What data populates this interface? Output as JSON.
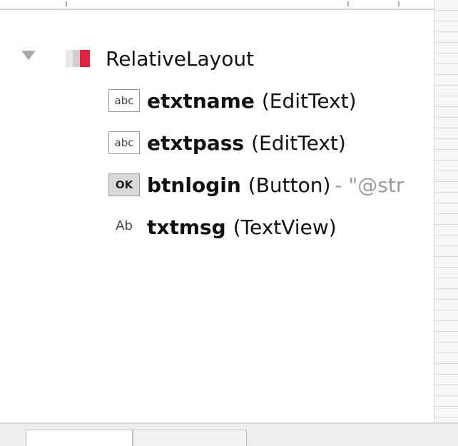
{
  "tree": {
    "root": {
      "label": "RelativeLayout"
    },
    "children": [
      {
        "icon_text": "abc",
        "id": "etxtname",
        "type": "(EditText)",
        "extra": ""
      },
      {
        "icon_text": "abc",
        "id": "etxtpass",
        "type": "(EditText)",
        "extra": ""
      },
      {
        "icon_text": "OK",
        "id": "btnlogin",
        "type": "(Button)",
        "extra": "- \"@str"
      },
      {
        "icon_text": "Ab",
        "id": "txtmsg",
        "type": "(TextView)",
        "extra": ""
      }
    ]
  }
}
